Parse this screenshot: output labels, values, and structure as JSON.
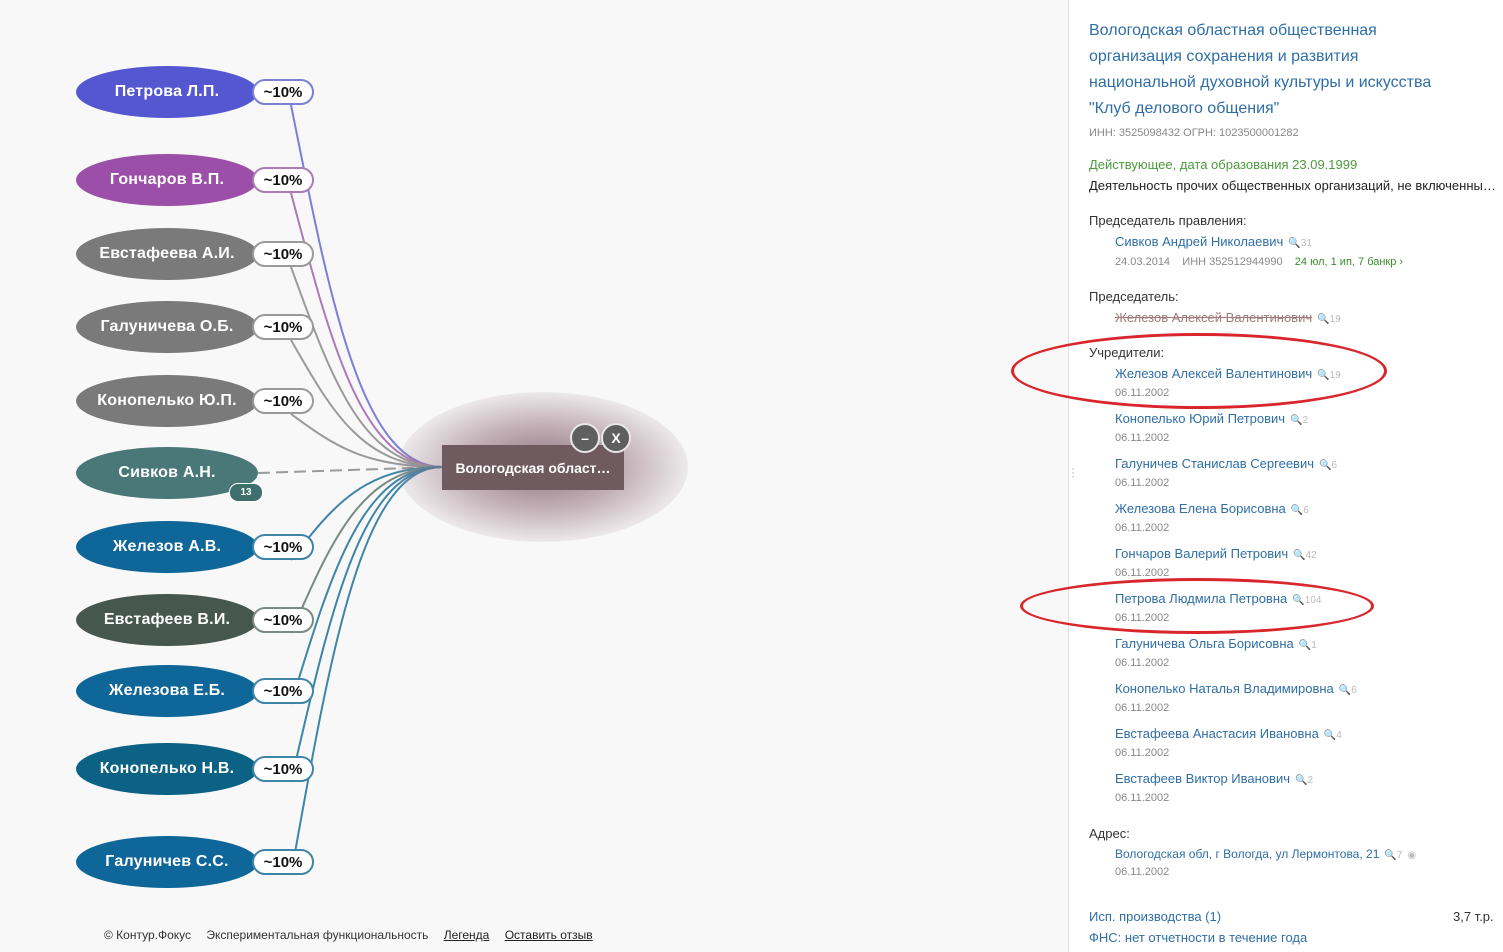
{
  "graph": {
    "nodes": [
      {
        "name": "Петрова Л.П.",
        "share": "~10%",
        "color": "#5457cf"
      },
      {
        "name": "Гончаров В.П.",
        "share": "~10%",
        "color": "#9b4fa8"
      },
      {
        "name": "Евстафеева А.И.",
        "share": "~10%",
        "color": "#7a7a7a"
      },
      {
        "name": "Галуничева О.Б.",
        "share": "~10%",
        "color": "#7a7a7a"
      },
      {
        "name": "Конопелько Ю.П.",
        "share": "~10%",
        "color": "#7a7a7a"
      },
      {
        "name": "Сивков А.Н.",
        "share": "",
        "color": "#4a7878",
        "badge": "13"
      },
      {
        "name": "Железов А.В.",
        "share": "~10%",
        "color": "#0f6699"
      },
      {
        "name": "Евстафеев В.И.",
        "share": "~10%",
        "color": "#46574f"
      },
      {
        "name": "Железова Е.Б.",
        "share": "~10%",
        "color": "#0f6699"
      },
      {
        "name": "Конопелько Н.В.",
        "share": "~10%",
        "color": "#0b6284"
      },
      {
        "name": "Галуничев С.С.",
        "share": "~10%",
        "color": "#0f6699"
      }
    ],
    "center": {
      "label": "Вологодская област…",
      "minus_label": "–",
      "close_label": "X"
    }
  },
  "footer": {
    "copyright": "© Контур.Фокус",
    "experimental": "Экспериментальная функциональность",
    "legend": "Легенда",
    "feedback": "Оставить отзыв"
  },
  "panel": {
    "title": "Вологодская областная общественная организация сохранения и развития национальной духовной культуры и искусства \"Клуб делового общения\"",
    "ids": "ИНН: 3525098432   ОГРН: 1023500001282",
    "status": "Действующее, дата образования 23.09.1999",
    "activity": "Деятельность прочих общественных организаций, не включенных в другие группировки",
    "board_chair_heading": "Председатель правления:",
    "board_chair": {
      "name": "Сивков Андрей Николаевич",
      "count": "31",
      "date": "24.03.2014",
      "inn": "ИНН 352512944990",
      "links": "24 юл, 1 ип, 7 банкр"
    },
    "chair_heading": "Председатель:",
    "chair": {
      "name": "Железов Алексей Валентинович",
      "count": "19"
    },
    "founders_heading": "Учредители:",
    "founders": [
      {
        "name": "Железов Алексей Валентинович",
        "count": "19",
        "date": "06.11.2002"
      },
      {
        "name": "Конопелько Юрий Петрович",
        "count": "2",
        "date": "06.11.2002"
      },
      {
        "name": "Галуничев Станислав Сергеевич",
        "count": "6",
        "date": "06.11.2002"
      },
      {
        "name": "Железова Елена Борисовна",
        "count": "6",
        "date": "06.11.2002"
      },
      {
        "name": "Гончаров Валерий Петрович",
        "count": "42",
        "date": "06.11.2002"
      },
      {
        "name": "Петрова Людмила Петровна",
        "count": "104",
        "date": "06.11.2002"
      },
      {
        "name": "Галуничева Ольга Борисовна",
        "count": "1",
        "date": "06.11.2002"
      },
      {
        "name": "Конопелько Наталья Владимировна",
        "count": "6",
        "date": "06.11.2002"
      },
      {
        "name": "Евстафеева Анастасия Ивановна",
        "count": "4",
        "date": "06.11.2002"
      },
      {
        "name": "Евстафеев Виктор Иванович",
        "count": "2",
        "date": "06.11.2002"
      }
    ],
    "address_heading": "Адрес:",
    "address": {
      "text": "Вологодская обл, г Вологда, ул Лермонтова, 21",
      "count": "7",
      "date": "06.11.2002"
    },
    "enforcement": "Исп. производства (1)",
    "enforcement_amount": "3,7 т.р.",
    "fns": "ФНС: нет отчетности в течение года"
  }
}
